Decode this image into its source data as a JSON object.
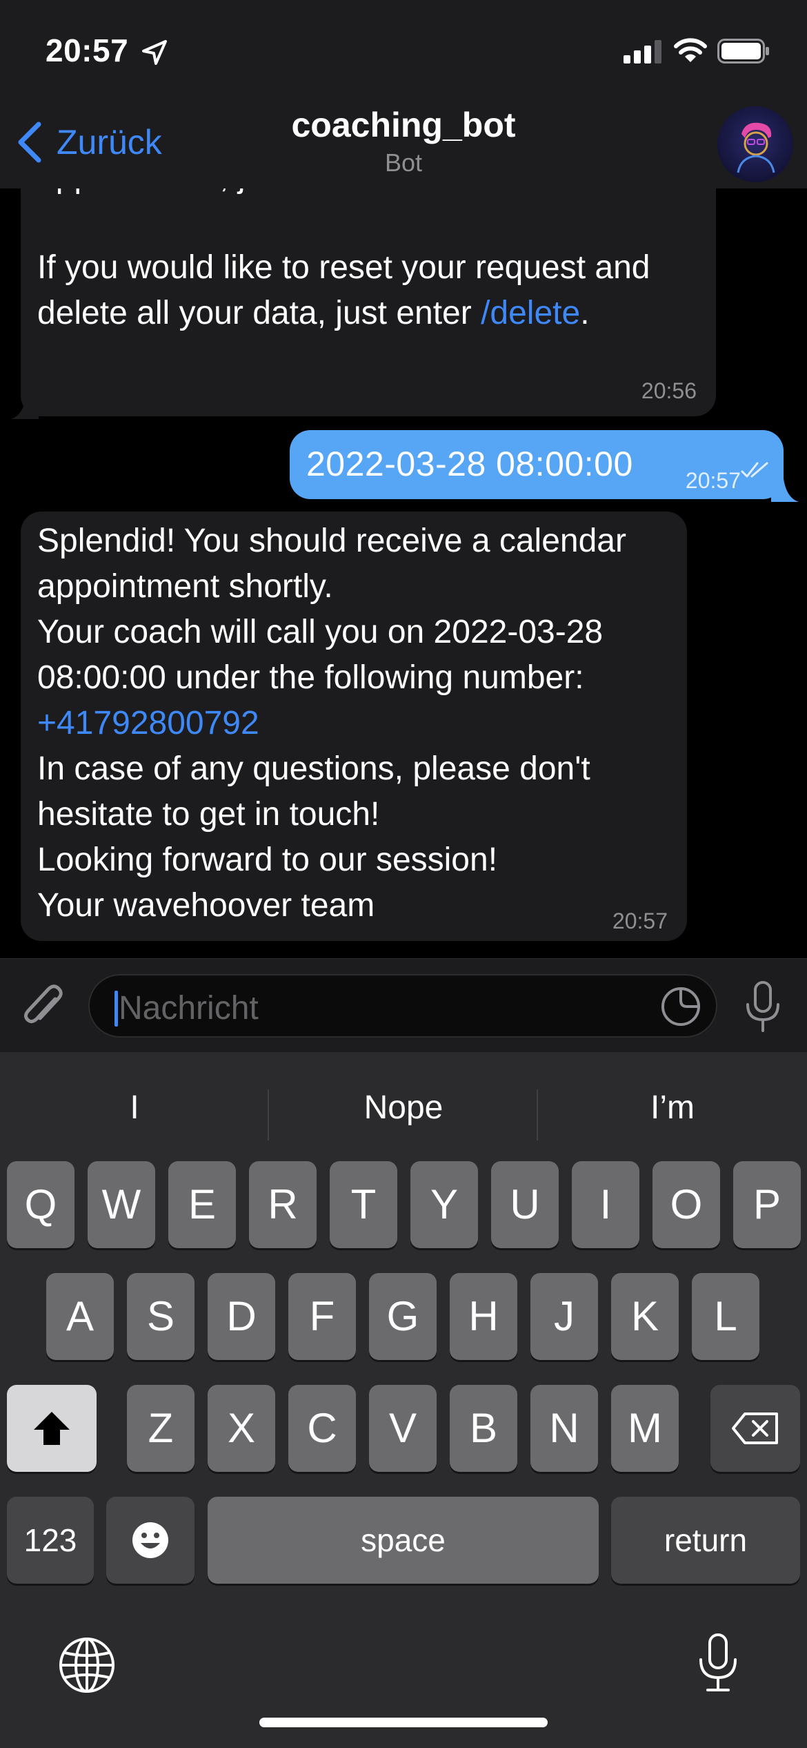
{
  "status_bar": {
    "time": "20:57",
    "icons": [
      "location-arrow-icon",
      "signal-icon",
      "wifi-icon",
      "battery-icon"
    ]
  },
  "nav": {
    "back_label": "Zurück",
    "title": "coaching_bot",
    "subtitle": "Bot",
    "avatar": "bot-avatar"
  },
  "messages": [
    {
      "direction": "incoming",
      "lines": [
        "appointment, just leave the chat.",
        "",
        "If you would like to reset your request and"
      ],
      "last_line_prefix": "delete all your data, just enter ",
      "command_link": "/delete",
      "last_line_suffix": ".",
      "time": "20:56"
    },
    {
      "direction": "outgoing",
      "text": "2022-03-28 08:00:00",
      "time": "20:57",
      "status": "read"
    },
    {
      "direction": "incoming",
      "lines": [
        "Splendid! You should receive a calendar",
        "appointment shortly.",
        "Your coach will call you on 2022-03-28",
        "08:00:00 under the following number:"
      ],
      "phone_link": "+41792800792",
      "lines_after": [
        "In case of any questions, please don't",
        "hesitate to get in touch!",
        "Looking forward to our session!",
        "Your wavehoover team"
      ],
      "time": "20:57"
    }
  ],
  "composer": {
    "placeholder": "Nachricht"
  },
  "keyboard": {
    "suggestions": [
      "I",
      "Nope",
      "I’m"
    ],
    "row1": [
      "Q",
      "W",
      "E",
      "R",
      "T",
      "Y",
      "U",
      "I",
      "O",
      "P"
    ],
    "row2": [
      "A",
      "S",
      "D",
      "F",
      "G",
      "H",
      "J",
      "K",
      "L"
    ],
    "row3": [
      "Z",
      "X",
      "C",
      "V",
      "B",
      "N",
      "M"
    ],
    "numbers_label": "123",
    "space_label": "space",
    "return_label": "return"
  },
  "colors": {
    "accent": "#3e88f7",
    "outgoing_bubble": "#57a5f5",
    "incoming_bubble": "#1c1c1e",
    "chat_background": "#000000",
    "keyboard_background": "#2b2b2d"
  }
}
